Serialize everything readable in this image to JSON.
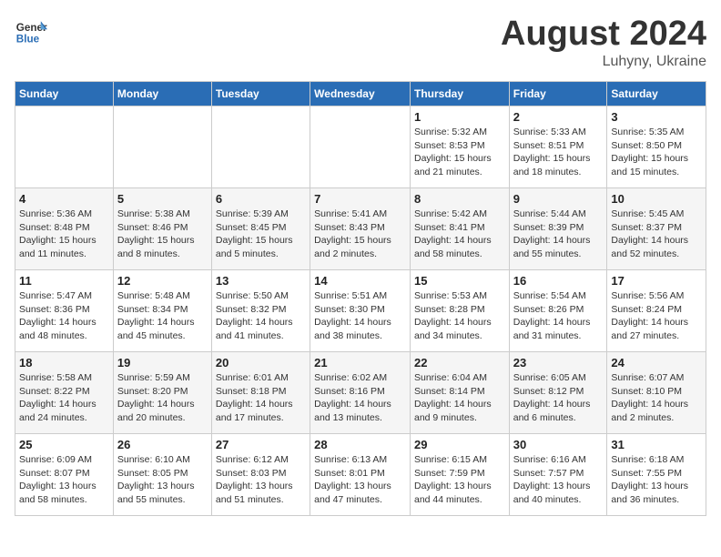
{
  "header": {
    "logo_general": "General",
    "logo_blue": "Blue",
    "title": "August 2024",
    "location": "Luhyny, Ukraine"
  },
  "weekdays": [
    "Sunday",
    "Monday",
    "Tuesday",
    "Wednesday",
    "Thursday",
    "Friday",
    "Saturday"
  ],
  "weeks": [
    [
      {
        "day": "",
        "info": ""
      },
      {
        "day": "",
        "info": ""
      },
      {
        "day": "",
        "info": ""
      },
      {
        "day": "",
        "info": ""
      },
      {
        "day": "1",
        "info": "Sunrise: 5:32 AM\nSunset: 8:53 PM\nDaylight: 15 hours\nand 21 minutes."
      },
      {
        "day": "2",
        "info": "Sunrise: 5:33 AM\nSunset: 8:51 PM\nDaylight: 15 hours\nand 18 minutes."
      },
      {
        "day": "3",
        "info": "Sunrise: 5:35 AM\nSunset: 8:50 PM\nDaylight: 15 hours\nand 15 minutes."
      }
    ],
    [
      {
        "day": "4",
        "info": "Sunrise: 5:36 AM\nSunset: 8:48 PM\nDaylight: 15 hours\nand 11 minutes."
      },
      {
        "day": "5",
        "info": "Sunrise: 5:38 AM\nSunset: 8:46 PM\nDaylight: 15 hours\nand 8 minutes."
      },
      {
        "day": "6",
        "info": "Sunrise: 5:39 AM\nSunset: 8:45 PM\nDaylight: 15 hours\nand 5 minutes."
      },
      {
        "day": "7",
        "info": "Sunrise: 5:41 AM\nSunset: 8:43 PM\nDaylight: 15 hours\nand 2 minutes."
      },
      {
        "day": "8",
        "info": "Sunrise: 5:42 AM\nSunset: 8:41 PM\nDaylight: 14 hours\nand 58 minutes."
      },
      {
        "day": "9",
        "info": "Sunrise: 5:44 AM\nSunset: 8:39 PM\nDaylight: 14 hours\nand 55 minutes."
      },
      {
        "day": "10",
        "info": "Sunrise: 5:45 AM\nSunset: 8:37 PM\nDaylight: 14 hours\nand 52 minutes."
      }
    ],
    [
      {
        "day": "11",
        "info": "Sunrise: 5:47 AM\nSunset: 8:36 PM\nDaylight: 14 hours\nand 48 minutes."
      },
      {
        "day": "12",
        "info": "Sunrise: 5:48 AM\nSunset: 8:34 PM\nDaylight: 14 hours\nand 45 minutes."
      },
      {
        "day": "13",
        "info": "Sunrise: 5:50 AM\nSunset: 8:32 PM\nDaylight: 14 hours\nand 41 minutes."
      },
      {
        "day": "14",
        "info": "Sunrise: 5:51 AM\nSunset: 8:30 PM\nDaylight: 14 hours\nand 38 minutes."
      },
      {
        "day": "15",
        "info": "Sunrise: 5:53 AM\nSunset: 8:28 PM\nDaylight: 14 hours\nand 34 minutes."
      },
      {
        "day": "16",
        "info": "Sunrise: 5:54 AM\nSunset: 8:26 PM\nDaylight: 14 hours\nand 31 minutes."
      },
      {
        "day": "17",
        "info": "Sunrise: 5:56 AM\nSunset: 8:24 PM\nDaylight: 14 hours\nand 27 minutes."
      }
    ],
    [
      {
        "day": "18",
        "info": "Sunrise: 5:58 AM\nSunset: 8:22 PM\nDaylight: 14 hours\nand 24 minutes."
      },
      {
        "day": "19",
        "info": "Sunrise: 5:59 AM\nSunset: 8:20 PM\nDaylight: 14 hours\nand 20 minutes."
      },
      {
        "day": "20",
        "info": "Sunrise: 6:01 AM\nSunset: 8:18 PM\nDaylight: 14 hours\nand 17 minutes."
      },
      {
        "day": "21",
        "info": "Sunrise: 6:02 AM\nSunset: 8:16 PM\nDaylight: 14 hours\nand 13 minutes."
      },
      {
        "day": "22",
        "info": "Sunrise: 6:04 AM\nSunset: 8:14 PM\nDaylight: 14 hours\nand 9 minutes."
      },
      {
        "day": "23",
        "info": "Sunrise: 6:05 AM\nSunset: 8:12 PM\nDaylight: 14 hours\nand 6 minutes."
      },
      {
        "day": "24",
        "info": "Sunrise: 6:07 AM\nSunset: 8:10 PM\nDaylight: 14 hours\nand 2 minutes."
      }
    ],
    [
      {
        "day": "25",
        "info": "Sunrise: 6:09 AM\nSunset: 8:07 PM\nDaylight: 13 hours\nand 58 minutes."
      },
      {
        "day": "26",
        "info": "Sunrise: 6:10 AM\nSunset: 8:05 PM\nDaylight: 13 hours\nand 55 minutes."
      },
      {
        "day": "27",
        "info": "Sunrise: 6:12 AM\nSunset: 8:03 PM\nDaylight: 13 hours\nand 51 minutes."
      },
      {
        "day": "28",
        "info": "Sunrise: 6:13 AM\nSunset: 8:01 PM\nDaylight: 13 hours\nand 47 minutes."
      },
      {
        "day": "29",
        "info": "Sunrise: 6:15 AM\nSunset: 7:59 PM\nDaylight: 13 hours\nand 44 minutes."
      },
      {
        "day": "30",
        "info": "Sunrise: 6:16 AM\nSunset: 7:57 PM\nDaylight: 13 hours\nand 40 minutes."
      },
      {
        "day": "31",
        "info": "Sunrise: 6:18 AM\nSunset: 7:55 PM\nDaylight: 13 hours\nand 36 minutes."
      }
    ]
  ]
}
